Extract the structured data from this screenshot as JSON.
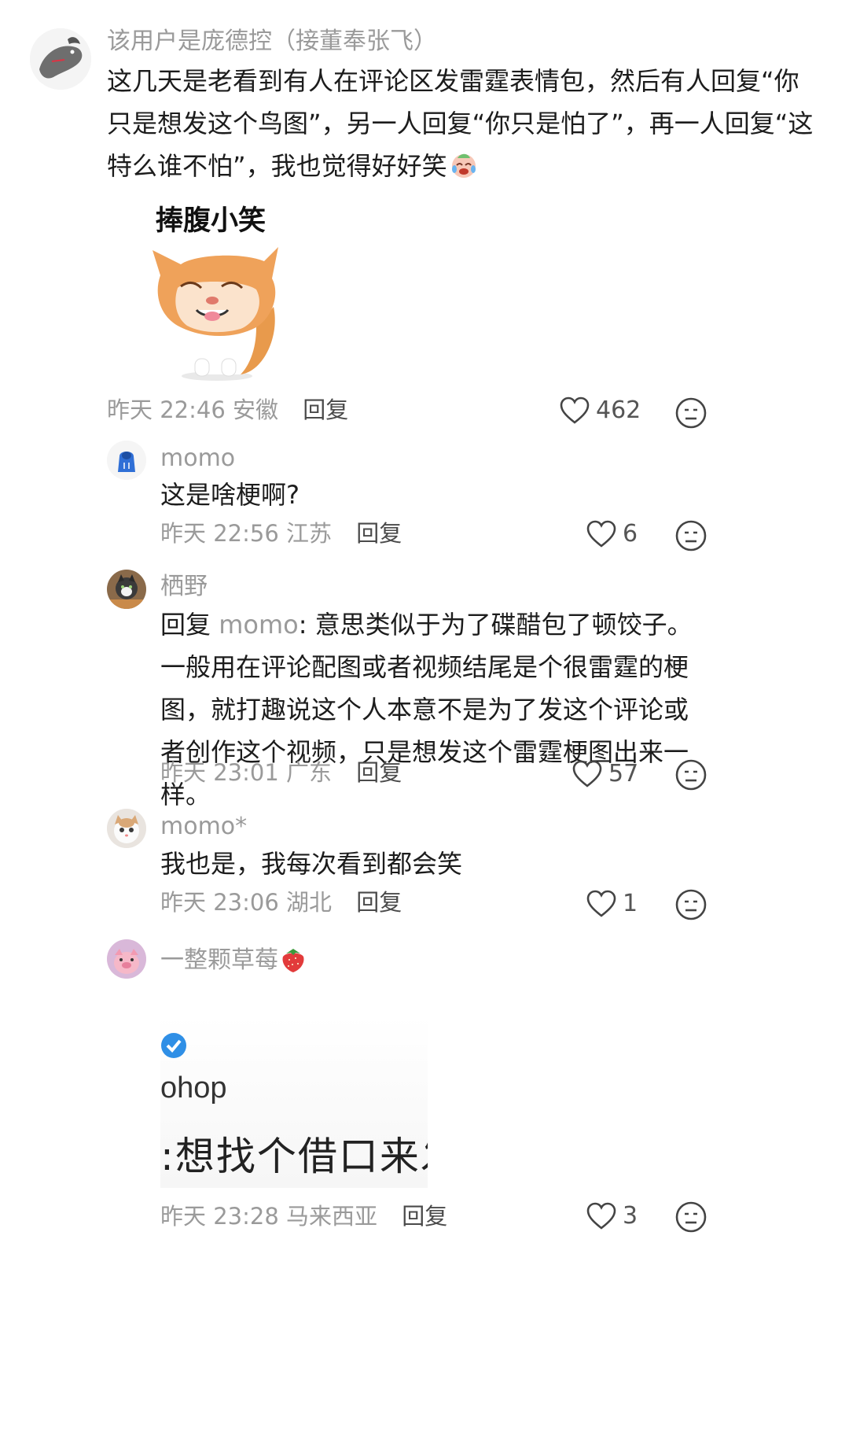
{
  "colors": {
    "muted": "#9a9a9a",
    "text": "#1c1c1c",
    "accent_check": "#2f8fe6",
    "strawberry": "#e23b3b"
  },
  "main_comment": {
    "username": "该用户是庞德控（接董奉张飞）",
    "text": "这几天是老看到有人在评论区发雷霆表情包，然后有人回复“你只是想发这个鸟图”，另一人回复“你只是怕了”，再一人回复“这特么谁不怕”，我也觉得好好笑",
    "emoji_icon": "crying-laughing-face-icon",
    "sticker_caption": "捧腹小笑",
    "sticker_icon": "laughing-cat-sticker",
    "time": "昨天 22:46",
    "location": "安徽",
    "reply_label": "回复",
    "likes": "462"
  },
  "replies": [
    {
      "username": "momo",
      "avatar_icon": "blue-hoodie-avatar",
      "text": "这是啥梗啊?",
      "time": "昨天 22:56",
      "location": "江苏",
      "reply_label": "回复",
      "likes": "6"
    },
    {
      "username": "栖野",
      "avatar_icon": "cat-photo-avatar",
      "reply_prefix": "回复",
      "reply_to": "momo",
      "colon": ":",
      "text": "意思类似于为了碟醋包了顿饺子。一般用在评论配图或者视频结尾是个很雷霆的梗图，就打趣说这个人本意不是为了发这个评论或者创作这个视频，只是想发这个雷霆梗图出来一样。",
      "time": "昨天 23:01",
      "location": "广东",
      "reply_label": "回复",
      "likes": "57"
    },
    {
      "username": "momo*",
      "avatar_icon": "kitten-avatar",
      "text": "我也是，我每次看到都会笑",
      "time": "昨天 23:06",
      "location": "湖北",
      "reply_label": "回复",
      "likes": "1"
    },
    {
      "username": "一整颗草莓",
      "avatar_icon": "pink-pig-avatar",
      "username_emoji": "strawberry-icon",
      "image_fragment": {
        "partial_name": "ohop",
        "partial_text": ":想找个借口来发"
      },
      "time": "昨天 23:28",
      "location": "马来西亚",
      "reply_label": "回复",
      "likes": "3"
    }
  ]
}
